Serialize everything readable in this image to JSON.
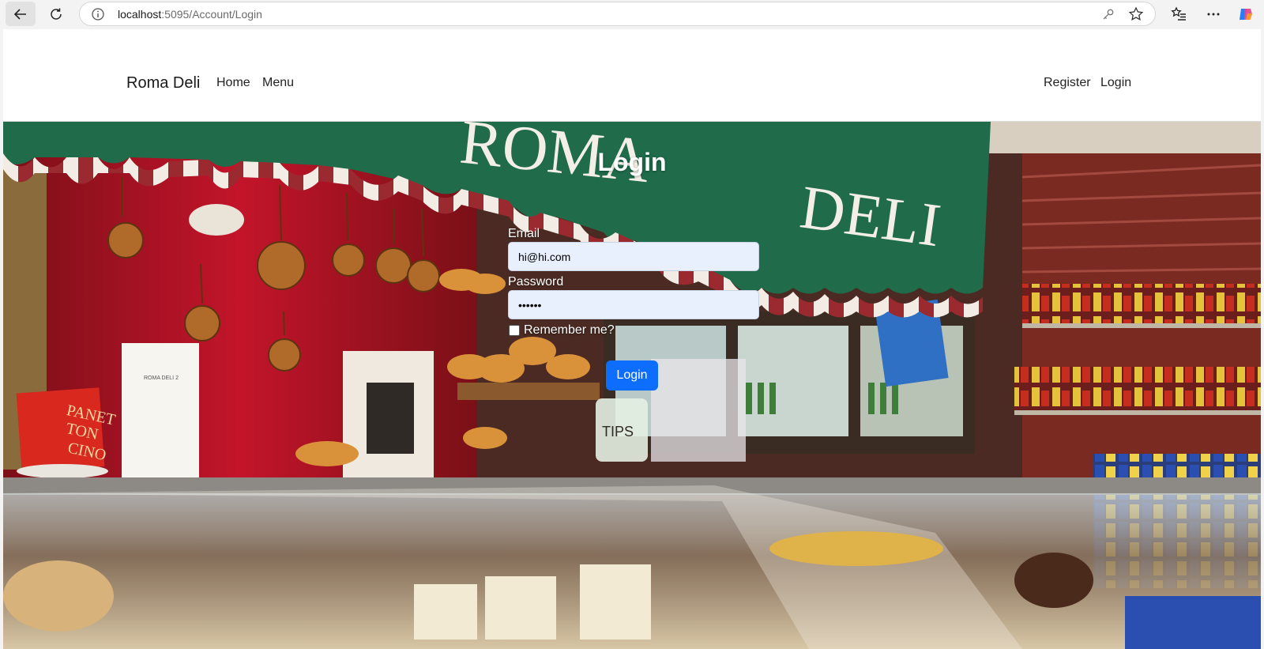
{
  "browser": {
    "url_host": "localhost",
    "url_path": ":5095/Account/Login"
  },
  "navbar": {
    "brand": "Roma Deli",
    "links": [
      "Home",
      "Menu"
    ],
    "auth_links": [
      "Register",
      "Login"
    ]
  },
  "scene": {
    "awning_text": [
      "ROMA",
      "DELI"
    ],
    "sign_text": [
      "PANET",
      "TON",
      "CINO"
    ],
    "menu_card_text": "ROMA DELI 2",
    "tips_jar_text": "TIPS"
  },
  "login": {
    "title": "Login",
    "email_label": "Email",
    "email_value": "hi@hi.com",
    "password_label": "Password",
    "password_value": "••••••",
    "remember_label": "Remember me?",
    "submit_label": "Login"
  },
  "colors": {
    "button": "#0d6efd",
    "input_bg": "#e8f0fe",
    "awning_green": "#1f6b4a",
    "wall_red": "#9c1020"
  }
}
